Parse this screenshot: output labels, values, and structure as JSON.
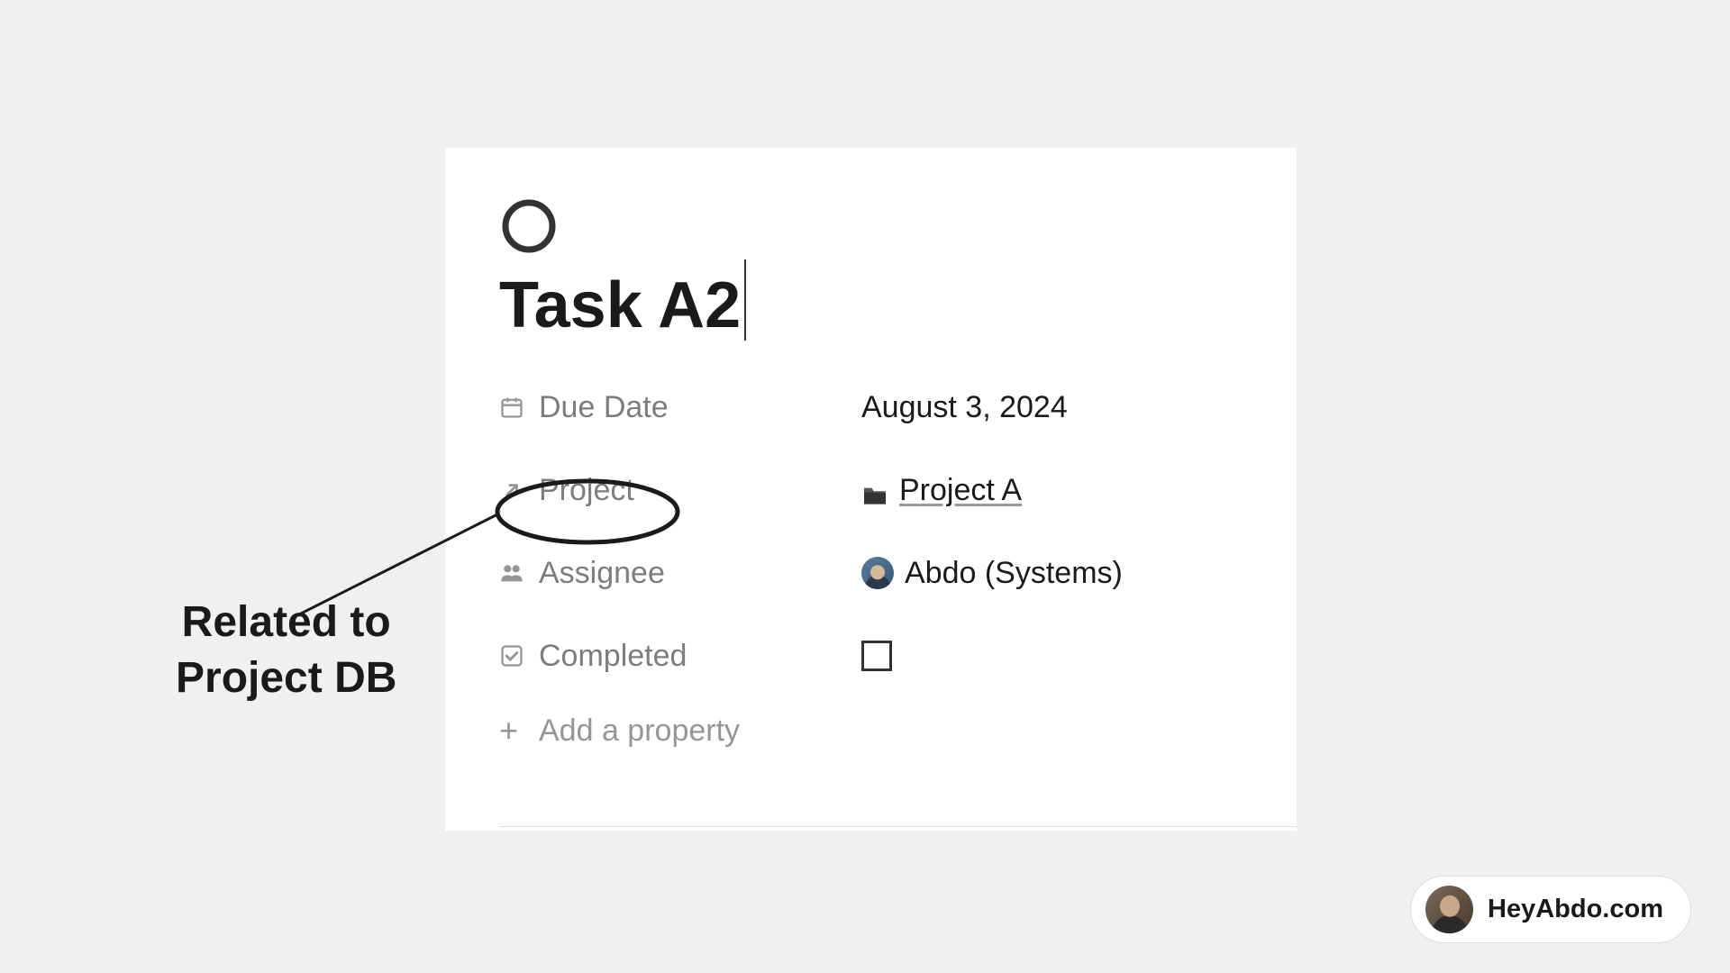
{
  "page": {
    "title": "Task A2"
  },
  "properties": {
    "due_date": {
      "label": "Due Date",
      "value": "August 3, 2024"
    },
    "project": {
      "label": "Project",
      "value": "Project A"
    },
    "assignee": {
      "label": "Assignee",
      "value": "Abdo (Systems)"
    },
    "completed": {
      "label": "Completed",
      "checked": false
    },
    "add_label": "Add a property"
  },
  "annotation": {
    "line1": "Related to",
    "line2": "Project DB"
  },
  "watermark": {
    "text": "HeyAbdo.com"
  }
}
